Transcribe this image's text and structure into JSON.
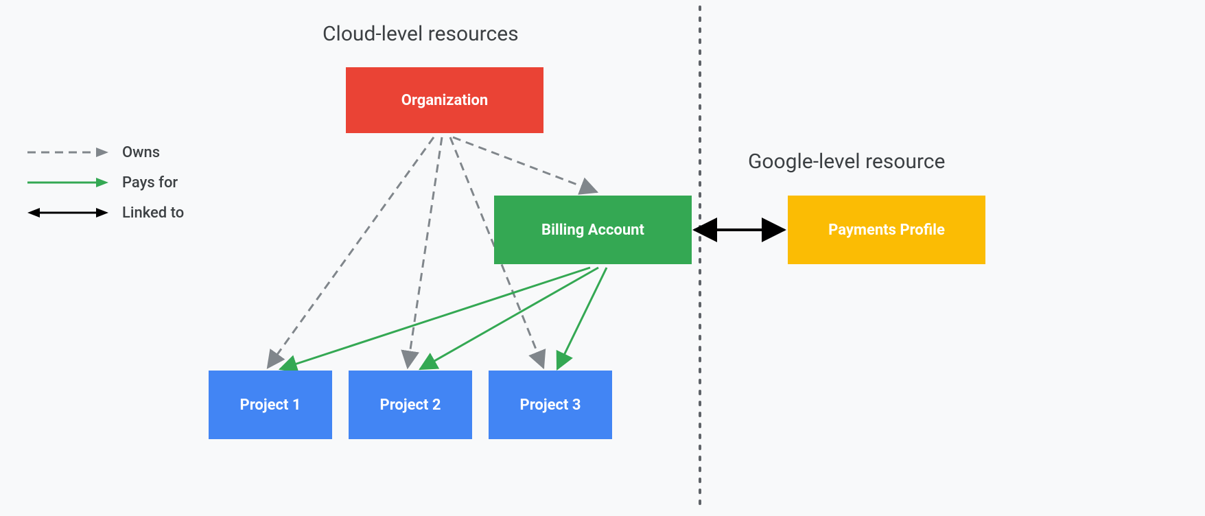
{
  "titles": {
    "cloud": "Cloud-level resources",
    "google": "Google-level resource"
  },
  "legend": {
    "owns": "Owns",
    "pays": "Pays for",
    "linked": "Linked to"
  },
  "boxes": {
    "organization": "Organization",
    "billing": "Billing Account",
    "payments": "Payments Profile",
    "project1": "Project 1",
    "project2": "Project 2",
    "project3": "Project 3"
  },
  "colors": {
    "org": "#ea4335",
    "billing": "#34a853",
    "payments": "#fbbc04",
    "project": "#4285f4",
    "owns_arrow": "#80868b",
    "pays_arrow": "#34a853",
    "linked_arrow": "#000000"
  }
}
